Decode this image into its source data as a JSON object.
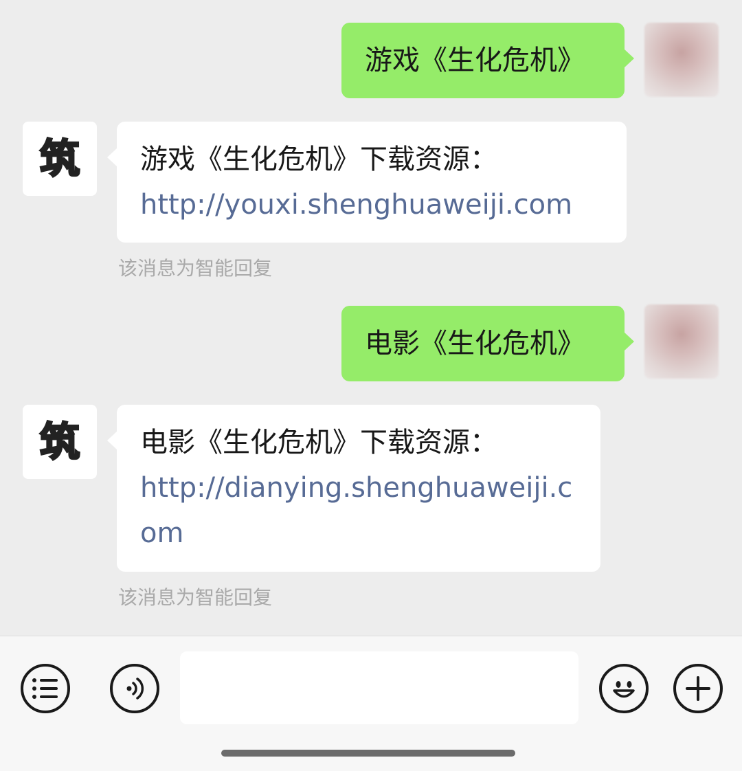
{
  "conversation": [
    {
      "sender": "user",
      "text": "游戏《生化危机》"
    },
    {
      "sender": "bot",
      "avatar_text": "筑",
      "text": "游戏《生化危机》下载资源：",
      "link": "http://youxi.shenghuaweiji.com",
      "notice": "该消息为智能回复"
    },
    {
      "sender": "user",
      "text": "电影《生化危机》"
    },
    {
      "sender": "bot",
      "avatar_text": "筑",
      "text": "电影《生化危机》下载资源：",
      "link": "http://dianying.shenghuaweiji.com",
      "notice": "该消息为智能回复"
    }
  ],
  "input_bar": {
    "menu_icon": "menu-list-icon",
    "voice_icon": "voice-icon",
    "emoji_icon": "emoji-icon",
    "plus_icon": "plus-icon",
    "input_value": ""
  },
  "colors": {
    "background": "#ededed",
    "sent_bubble": "#95ec69",
    "received_bubble": "#ffffff",
    "link": "#576b95",
    "notice": "#a9a9a9"
  }
}
